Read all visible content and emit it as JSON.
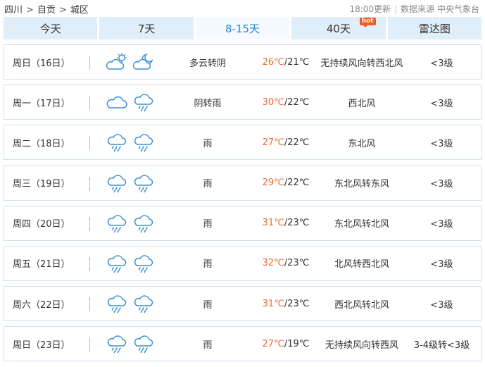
{
  "breadcrumb": [
    "四川",
    "自贡",
    "城区"
  ],
  "breadcrumb_separator": ">",
  "update": {
    "time": "18:00更新",
    "source": "数据来源 中央气象台"
  },
  "tabs": [
    {
      "label": "今天",
      "active": false,
      "badge": ""
    },
    {
      "label": "7天",
      "active": false,
      "badge": ""
    },
    {
      "label": "8-15天",
      "active": true,
      "badge": ""
    },
    {
      "label": "40天",
      "active": false,
      "badge": "hot"
    },
    {
      "label": "雷达图",
      "active": false,
      "badge": ""
    }
  ],
  "colors": {
    "accent": "#2b86d3",
    "tab_bg": "#dfeef9",
    "high_temp": "#f06a2d",
    "hot_badge": "#f15a22",
    "icon": "#3a8fd6"
  },
  "days": [
    {
      "day": "周日（16日）",
      "icons": [
        "partly-cloudy-day-icon",
        "partly-cloudy-night-icon"
      ],
      "weather": "多云转阴",
      "high": "26℃",
      "low": "/21℃",
      "wind": "无持续风向转西北风",
      "level": "<3级"
    },
    {
      "day": "周一（17日）",
      "icons": [
        "cloudy-icon",
        "rain-icon"
      ],
      "weather": "阴转雨",
      "high": "30℃",
      "low": "/22℃",
      "wind": "西北风",
      "level": "<3级"
    },
    {
      "day": "周二（18日）",
      "icons": [
        "rain-icon",
        "rain-icon"
      ],
      "weather": "雨",
      "high": "27℃",
      "low": "/22℃",
      "wind": "东北风",
      "level": "<3级"
    },
    {
      "day": "周三（19日）",
      "icons": [
        "rain-icon",
        "rain-icon"
      ],
      "weather": "雨",
      "high": "29℃",
      "low": "/22℃",
      "wind": "东北风转东风",
      "level": "<3级"
    },
    {
      "day": "周四（20日）",
      "icons": [
        "rain-icon",
        "rain-icon"
      ],
      "weather": "雨",
      "high": "31℃",
      "low": "/23℃",
      "wind": "东北风转北风",
      "level": "<3级"
    },
    {
      "day": "周五（21日）",
      "icons": [
        "rain-icon",
        "rain-icon"
      ],
      "weather": "雨",
      "high": "32℃",
      "low": "/23℃",
      "wind": "北风转西北风",
      "level": "<3级"
    },
    {
      "day": "周六（22日）",
      "icons": [
        "rain-icon",
        "rain-icon"
      ],
      "weather": "雨",
      "high": "31℃",
      "low": "/23℃",
      "wind": "西北风转北风",
      "level": "<3级"
    },
    {
      "day": "周日（23日）",
      "icons": [
        "rain-icon",
        "rain-icon"
      ],
      "weather": "雨",
      "high": "27℃",
      "low": "/19℃",
      "wind": "无持续风向转西风",
      "level": "3-4级转<3级"
    }
  ]
}
